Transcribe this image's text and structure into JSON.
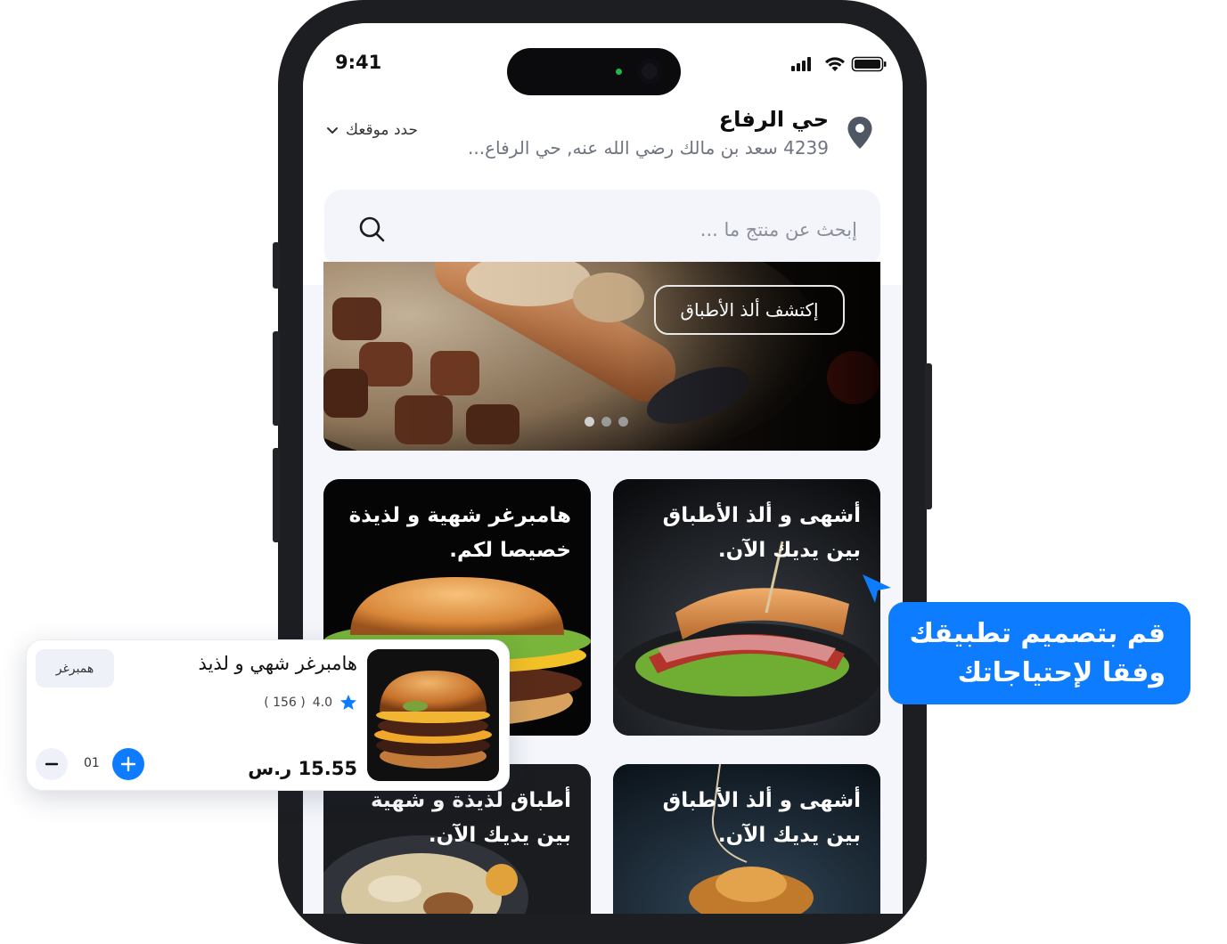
{
  "status_bar": {
    "time": "9:41"
  },
  "location": {
    "title": "حي الرفاع",
    "address": "4239 سعد بن مالك رضي الله عنه, حي الرفاع...",
    "select_label": "حدد موقعك"
  },
  "search": {
    "placeholder": "إبحث عن منتج ما ..."
  },
  "banner": {
    "button_label": "إكتشف ألذ الأطباق",
    "slide_count": 3,
    "active_slide": 1
  },
  "cards": [
    {
      "title_line1": "أشهى و ألذ الأطباق",
      "title_line2": "بين يديك الآن."
    },
    {
      "title_line1": "هامبرغر شهية و لذيذة",
      "title_line2": "خصيصا لكم."
    },
    {
      "title_line1": "أشهى و ألذ الأطباق",
      "title_line2": "بين يديك الآن."
    },
    {
      "title_line1": "أطباق لذيذة و شهية",
      "title_line2": "بين يديك الآن."
    }
  ],
  "product": {
    "name": "هامبرغر شهي و لذيذ",
    "rating": "4.0",
    "reviews": "( 156 )",
    "price": "15.55 ر.س",
    "category": "همبرغر",
    "quantity": "01"
  },
  "tooltip": {
    "line1": "قم بتصميم تطبيقك",
    "line2": "وفقا لإحتياجاتك"
  },
  "colors": {
    "accent": "#0d7cff",
    "phone_frame": "#1d1e22",
    "screen_bg": "#f4f6fb"
  },
  "icons": [
    "location-pin-icon",
    "chevron-down-icon",
    "search-icon",
    "star-icon",
    "minus-icon",
    "plus-icon",
    "cursor-arrow-icon",
    "signal-icon",
    "wifi-icon",
    "battery-icon"
  ]
}
